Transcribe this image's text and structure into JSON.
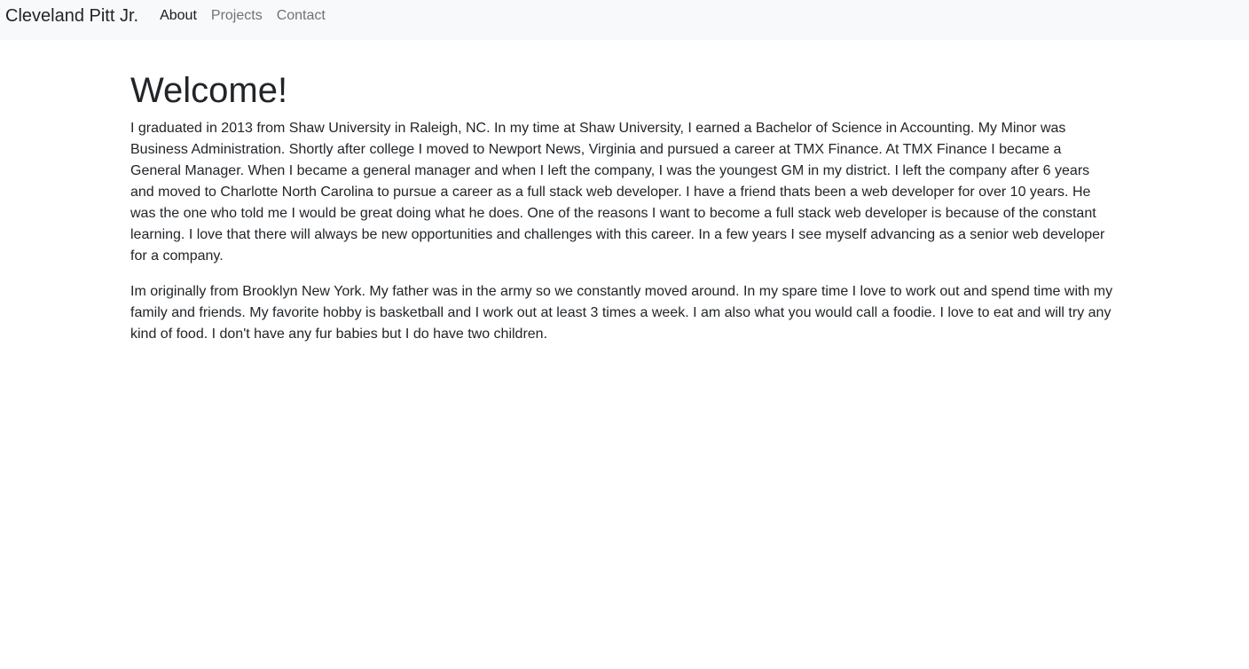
{
  "navbar": {
    "brand": "Cleveland Pitt Jr.",
    "links": [
      {
        "label": "About",
        "active": true
      },
      {
        "label": "Projects",
        "active": false
      },
      {
        "label": "Contact",
        "active": false
      }
    ]
  },
  "main": {
    "heading": "Welcome!",
    "paragraphs": [
      "I graduated in 2013 from Shaw University in Raleigh, NC. In my time at Shaw University, I earned a Bachelor of Science in Accounting. My Minor was Business Administration. Shortly after college I moved to Newport News, Virginia and pursued a career at TMX Finance. At TMX Finance I became a General Manager. When I became a general manager and when I left the company, I was the youngest GM in my district. I left the company after 6 years and moved to Charlotte North Carolina to pursue a career as a full stack web developer. I have a friend thats been a web developer for over 10 years. He was the one who told me I would be great doing what he does. One of the reasons I want to become a full stack web developer is because of the constant learning. I love that there will always be new opportunities and challenges with this career. In a few years I see myself advancing as a senior web developer for a company.",
      "Im originally from Brooklyn New York. My father was in the army so we constantly moved around. In my spare time I love to work out and spend time with my family and friends. My favorite hobby is basketball and I work out at least 3 times a week. I am also what you would call a foodie. I love to eat and will try any kind of food. I don't have any fur babies but I do have two children."
    ]
  }
}
